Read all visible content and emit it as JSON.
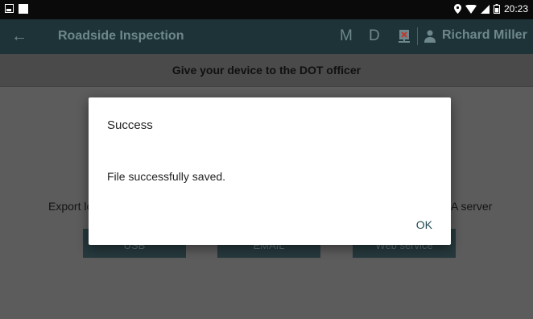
{
  "status_bar": {
    "time": "20:23",
    "icons": [
      "image-icon",
      "square-icon",
      "location-icon",
      "wifi-icon",
      "signal-icon",
      "battery-icon"
    ]
  },
  "app_bar": {
    "title": "Roadside Inspection",
    "mode_m": "M",
    "mode_d": "D",
    "user_name": "Richard  Miller",
    "icons": [
      "back-arrow-icon",
      "sync-error-icon",
      "person-icon"
    ]
  },
  "banner": {
    "text": "Give your device to the DOT officer"
  },
  "content": {
    "export_left": "Export lo",
    "export_right": "A server",
    "buttons": [
      "USB",
      "EMAIL",
      "Web service"
    ]
  },
  "dialog": {
    "title": "Success",
    "message": "File successfully saved.",
    "ok_label": "OK"
  },
  "colors": {
    "app_bar": "#1e3338",
    "overlay": "#5c5c5c",
    "button": "#26393d",
    "accent": "#1f4a52"
  }
}
